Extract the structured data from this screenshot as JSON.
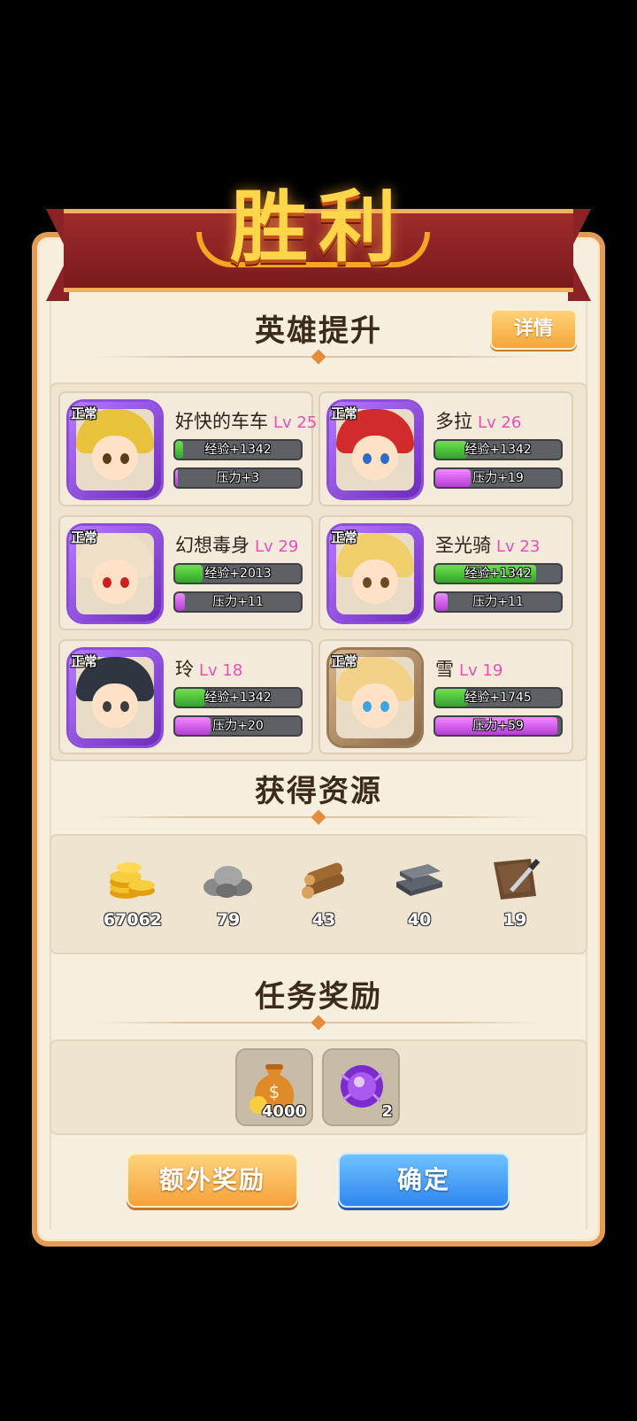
{
  "banner": {
    "title": "胜利"
  },
  "heroes_section": {
    "title": "英雄提升",
    "detail_button": "详情",
    "heroes": [
      {
        "status": "正常",
        "name": "好快的车车",
        "level": "Lv 25",
        "exp": "经验+1342",
        "exp_fill": 0.06,
        "stress": "压力+3",
        "stress_fill": 0.02,
        "frame": "purple",
        "hair": "#e8c23a",
        "eyes": "#5a3b1a"
      },
      {
        "status": "正常",
        "name": "多拉",
        "level": "Lv 26",
        "exp": "经验+1342",
        "exp_fill": 0.25,
        "stress": "压力+19",
        "stress_fill": 0.28,
        "frame": "purple",
        "hair": "#d22b2b",
        "eyes": "#2f6cc8"
      },
      {
        "status": "正常",
        "name": "幻想毒身",
        "level": "Lv 29",
        "exp": "经验+2013",
        "exp_fill": 0.22,
        "stress": "压力+11",
        "stress_fill": 0.08,
        "frame": "purple",
        "hair": "#f0e0c8",
        "eyes": "#cc2020"
      },
      {
        "status": "正常",
        "name": "圣光骑",
        "level": "Lv 23",
        "exp": "经验+1342",
        "exp_fill": 0.8,
        "stress": "压力+11",
        "stress_fill": 0.1,
        "frame": "purple",
        "hair": "#f0cf6a",
        "eyes": "#6a4a20"
      },
      {
        "status": "正常",
        "name": "玲",
        "level": "Lv 18",
        "exp": "经验+1342",
        "exp_fill": 0.24,
        "stress": "压力+20",
        "stress_fill": 0.28,
        "frame": "purple",
        "hair": "#2f3642",
        "eyes": "#3d3d3d"
      },
      {
        "status": "正常",
        "name": "雪",
        "level": "Lv 19",
        "exp": "经验+1745",
        "exp_fill": 0.26,
        "stress": "压力+59",
        "stress_fill": 0.97,
        "frame": "brown",
        "hair": "#f1d288",
        "eyes": "#3aa5e0"
      }
    ]
  },
  "resources_section": {
    "title": "获得资源",
    "items": [
      {
        "icon": "gold-coins-icon",
        "count": "67062"
      },
      {
        "icon": "stone-icon",
        "count": "79"
      },
      {
        "icon": "wood-logs-icon",
        "count": "43"
      },
      {
        "icon": "iron-ingot-icon",
        "count": "40"
      },
      {
        "icon": "leather-icon",
        "count": "19"
      }
    ]
  },
  "tasks_section": {
    "title": "任务奖励",
    "rewards": [
      {
        "icon": "money-bag-icon",
        "count": "4000"
      },
      {
        "icon": "purple-crystal-icon",
        "count": "2"
      }
    ]
  },
  "buttons": {
    "extra": "额外奖励",
    "confirm": "确定"
  },
  "colors": {
    "panel": "#f6efe0",
    "border": "#e39a55",
    "level": "#e94fb6",
    "ribbon": "#8a2226"
  }
}
